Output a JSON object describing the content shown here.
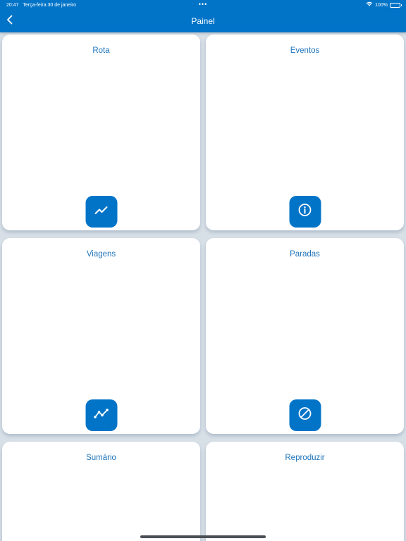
{
  "status_bar": {
    "time": "20:47",
    "date": "Terça-feira 30 de janeiro",
    "battery": "100%",
    "battery_level": 1.0,
    "wifi_icon": "wifi-icon"
  },
  "nav": {
    "title": "Painel",
    "back_icon": "chevron-left-icon"
  },
  "tiles": [
    {
      "label": "Rota",
      "icon": "trend-line-icon"
    },
    {
      "label": "Eventos",
      "icon": "info-circle-icon"
    },
    {
      "label": "Viagens",
      "icon": "route-points-icon"
    },
    {
      "label": "Paradas",
      "icon": "block-icon"
    },
    {
      "label": "Sumário",
      "icon": ""
    },
    {
      "label": "Reproduzir",
      "icon": ""
    }
  ],
  "colors": {
    "primary": "#0274c8",
    "title_text": "#1f74ba",
    "background": "#d7dfe7",
    "card": "#ffffff"
  }
}
